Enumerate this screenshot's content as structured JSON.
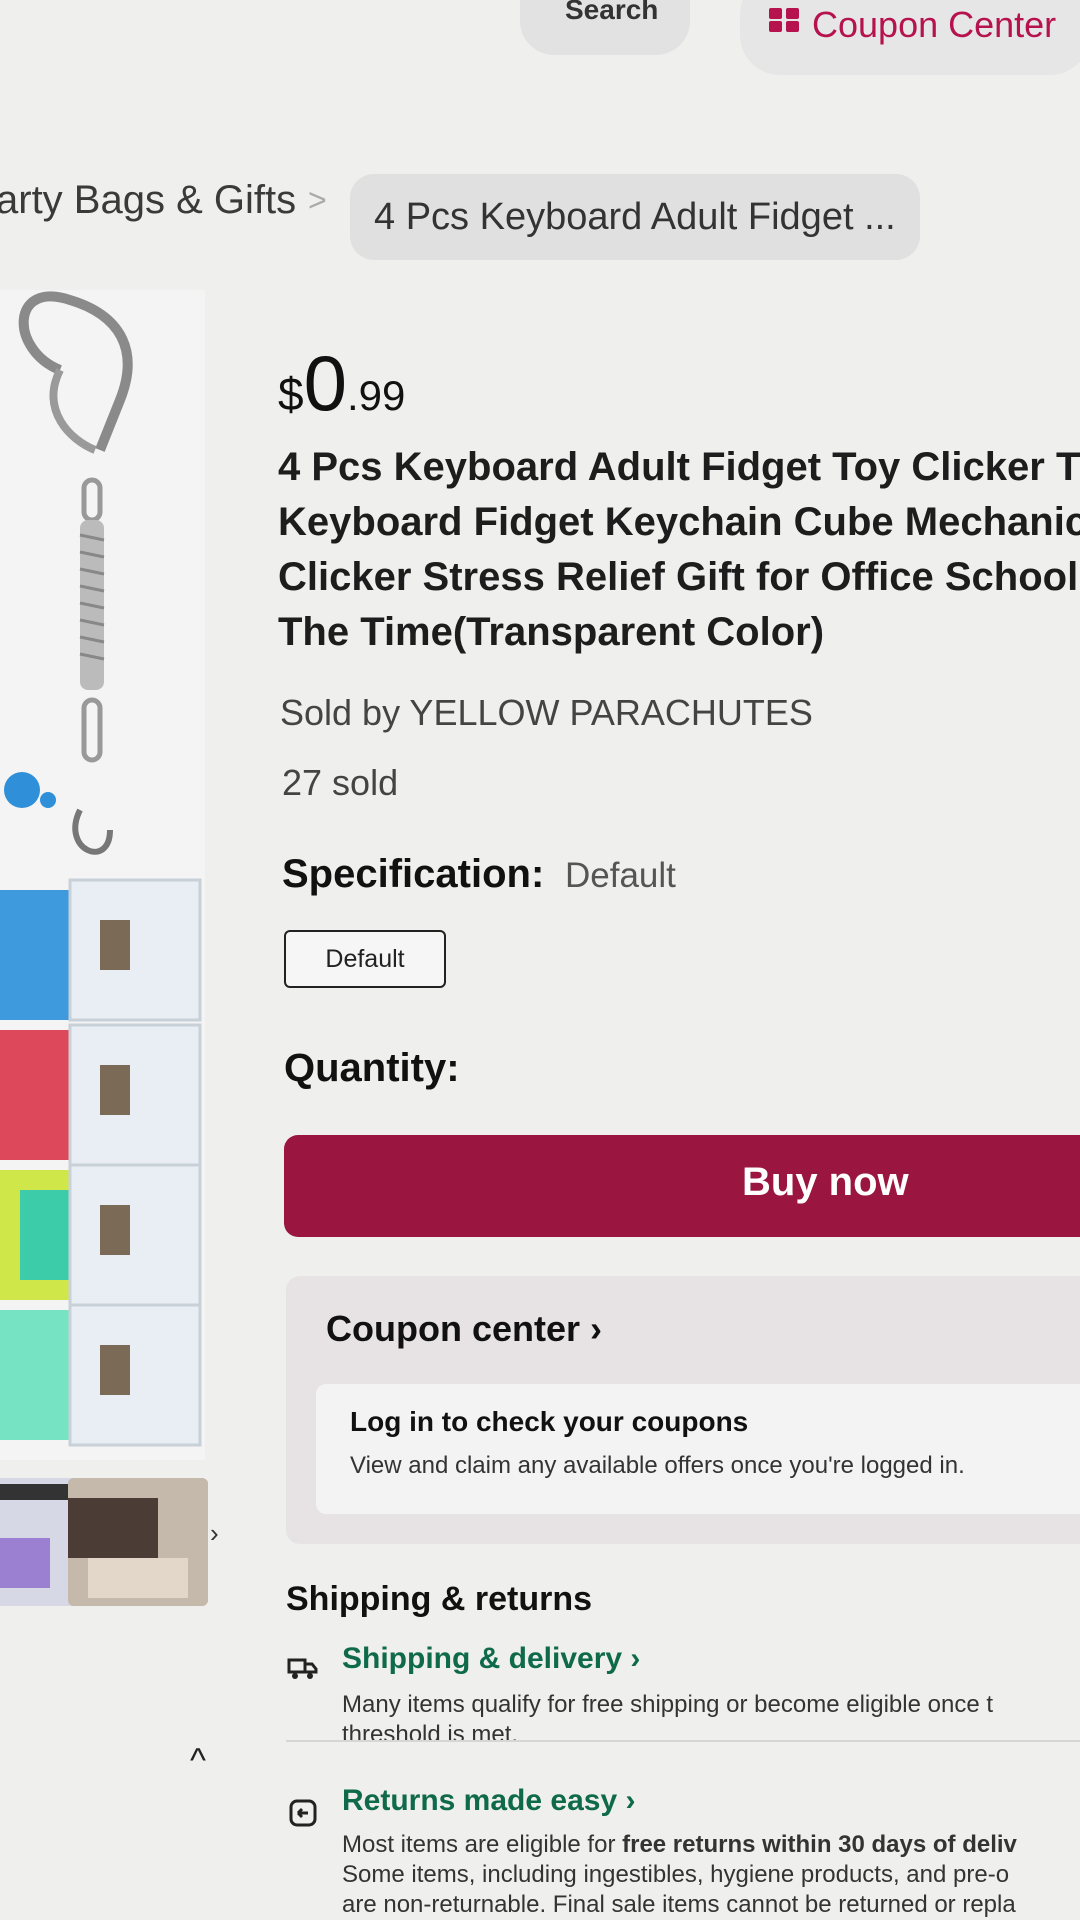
{
  "header": {
    "search_label": "Search",
    "coupon_center_label": "Coupon Center"
  },
  "breadcrumb": {
    "parent": "arty Bags & Gifts",
    "separator": ">",
    "current": "4 Pcs Keyboard Adult Fidget ..."
  },
  "gallery": {
    "next_icon": "chevron-right-icon",
    "scroll_top_icon": "chevron-up-icon"
  },
  "product": {
    "price_currency": "$",
    "price_integer": "0",
    "price_decimal": ".99",
    "title_lines": [
      "4 Pcs Keyboard Adult Fidget Toy Clicker T",
      "Keyboard Fidget Keychain Cube Mechanic",
      "Clicker Stress Relief Gift for Office School",
      "The Time(Transparent Color)"
    ],
    "seller": "Sold by YELLOW PARACHUTES",
    "sold_count": "27 sold",
    "specification_label": "Specification:",
    "specification_value": "Default",
    "specification_option": "Default",
    "quantity_label": "Quantity:",
    "buy_now_label": "Buy now"
  },
  "coupon_card": {
    "title": "Coupon center",
    "login_title": "Log in to check your coupons",
    "login_desc": "View and claim any available offers once you're logged in."
  },
  "shipping": {
    "heading": "Shipping & returns",
    "delivery_link": "Shipping & delivery",
    "delivery_desc_1": "Many items qualify for free shipping or become eligible once t",
    "delivery_desc_2": "threshold is met.",
    "returns_link": "Returns made easy",
    "returns_desc_1a": "Most items are eligible for ",
    "returns_desc_1b": "free returns within 30 days of deliv",
    "returns_desc_2": "Some items, including ingestibles, hygiene products, and pre-o",
    "returns_desc_3": "are non-returnable. Final sale items cannot be returned or repla"
  },
  "colors": {
    "brand": "#9a1540",
    "link_green": "#0f6a4c"
  }
}
